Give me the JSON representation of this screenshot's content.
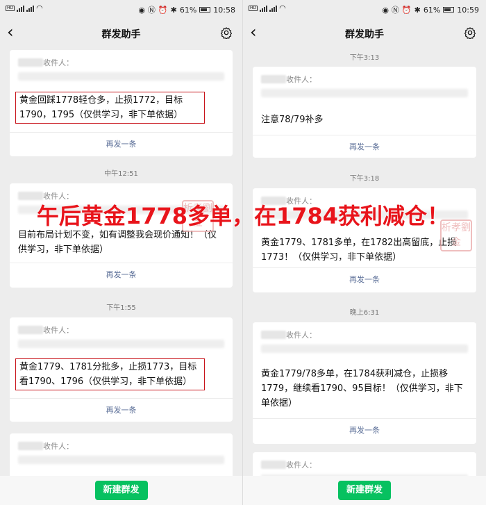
{
  "overlay": {
    "text": "午后黄金1778多单，在1784获利减仓！"
  },
  "left_screen": {
    "status": {
      "battery": "61%",
      "time": "10:58"
    },
    "nav": {
      "title": "群发助手"
    },
    "messages": [
      {
        "timestamp": "",
        "recipients_label": "收件人：",
        "text": "黄金回踩1778轻仓多，止损1772，目标1790，1795（仅供学习，非下单依据）",
        "resend": "再发一条"
      },
      {
        "timestamp": "中午12:51",
        "recipients_label": "收件人：",
        "text": "目前布局计划不变，如有调整我会现价通知！（仅供学习，非下单依据）",
        "resend": "再发一条"
      },
      {
        "timestamp": "下午1:55",
        "recipients_label": "收件人：",
        "text": "黄金1779、1781分批多，止损1773，目标看1790、1796（仅供学习，非下单依据）",
        "resend": "再发一条"
      },
      {
        "timestamp": "",
        "recipients_label": "收件人：",
        "text": "",
        "resend": ""
      }
    ],
    "bottom": {
      "new_button": "新建群发"
    }
  },
  "right_screen": {
    "status": {
      "battery": "61%",
      "time": "10:59"
    },
    "nav": {
      "title": "群发助手"
    },
    "messages": [
      {
        "timestamp": "下午3:13",
        "recipients_label": "收件人：",
        "text": "注意78/79补多",
        "resend": "再发一条"
      },
      {
        "timestamp": "下午3:18",
        "recipients_label": "收件人：",
        "text": "黄金1779、1781多单，在1782出高留底，止损1773！（仅供学习，非下单依据）",
        "resend": "再发一条"
      },
      {
        "timestamp": "晚上6:31",
        "recipients_label": "收件人：",
        "text": "黄金1779/78多单，在1784获利减仓，止损移1779，继续看1790、95目标！（仅供学习，非下单依据）",
        "resend": "再发一条"
      },
      {
        "timestamp": "",
        "recipients_label": "收件人：",
        "text": "",
        "resend": ""
      }
    ],
    "bottom": {
      "new_button": "新建群发"
    }
  },
  "seal": {
    "chars": [
      "析",
      "孝",
      "劉",
      "金"
    ]
  },
  "colors": {
    "accent_green": "#07c160",
    "link_blue": "#576b95",
    "highlight_red": "#c8141b"
  }
}
